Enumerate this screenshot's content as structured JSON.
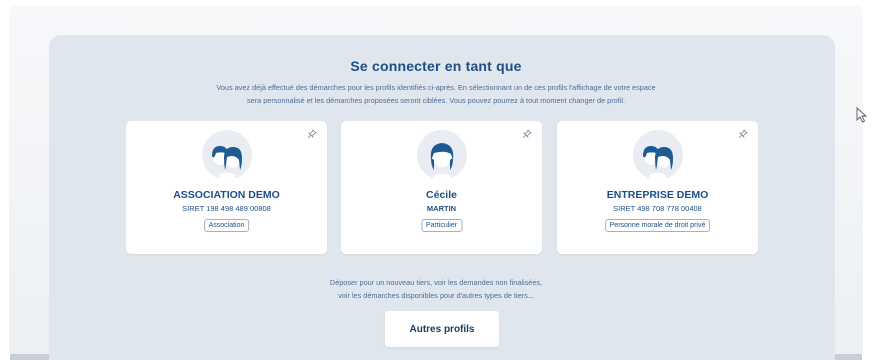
{
  "page": {
    "title": "Se connecter en tant que",
    "intro_line1": "Vous avez déjà effectué des démarches pour les profils identifiés ci-après. En sélectionnant un de ces profils l'affichage de votre espace",
    "intro_line2": "sera personnalisé et les démarches proposées seront ciblées. Vous pouvez pourrez à tout moment changer de profil."
  },
  "profiles": [
    {
      "name": "ASSOCIATION DEMO",
      "sub": "SIRET 198 498 489 00808",
      "tag": "Association",
      "avatar": "group-avatar-icon"
    },
    {
      "name": "Cécile",
      "sub": "MARTIN",
      "tag": "Particulier",
      "avatar": "person-avatar-icon"
    },
    {
      "name": "ENTREPRISE DEMO",
      "sub": "SIRET 498 708 778 00408",
      "tag": "Personne morale de droit privé",
      "avatar": "group-avatar-icon"
    }
  ],
  "footer": {
    "line1": "Déposer pour un nouveau tiers, voir les demandes non finalisées,",
    "line2": "voir les démarches disponibles pour d'autres types de tiers...",
    "button_label": "Autres profils"
  },
  "colors": {
    "accent": "#1d4f86",
    "panel": "#dfe6ee",
    "avatar_hair": "#1f5a92"
  }
}
